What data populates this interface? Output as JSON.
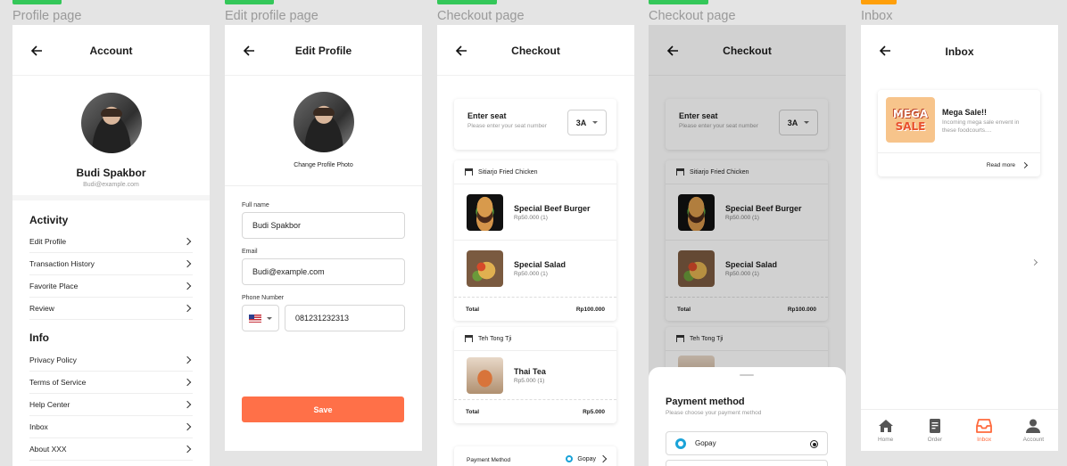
{
  "frames": [
    {
      "title": "Profile page",
      "tag_color": "#34c759"
    },
    {
      "title": "Edit profile page",
      "tag_color": "#34c759"
    },
    {
      "title": "Checkout page",
      "tag_color": "#34c759"
    },
    {
      "title": "Checkout page",
      "tag_color": "#34c759"
    },
    {
      "title": "Inbox",
      "tag_color": "#ff9f0a"
    }
  ],
  "account": {
    "header": "Account",
    "name": "Budi Spakbor",
    "email": "Budi@example.com",
    "activity_title": "Activity",
    "activity_items": [
      "Edit Profile",
      "Transaction History",
      "Favorite Place",
      "Review"
    ],
    "info_title": "Info",
    "info_items": [
      "Privacy Policy",
      "Terms of Service",
      "Help Center",
      "Inbox",
      "About XXX"
    ]
  },
  "edit_profile": {
    "header": "Edit Profile",
    "change_photo": "Change Profile Photo",
    "full_name_label": "Full name",
    "full_name_value": "Budi Spakbor",
    "email_label": "Email",
    "email_value": "Budi@example.com",
    "phone_label": "Phone Number",
    "phone_value": "081231232313",
    "save_label": "Save"
  },
  "checkout": {
    "header": "Checkout",
    "seat_title": "Enter seat",
    "seat_desc": "Please enter your seat number",
    "seat_value": "3A",
    "store1": "Sitiarjo Fried Chicken",
    "item1_name": "Special Beef Burger",
    "item1_price": "Rp50.000",
    "item1_qty": "(1)",
    "item2_name": "Special Salad",
    "item2_price": "Rp50.000",
    "item2_qty": "(1)",
    "total_label": "Total",
    "total1": "Rp100.000",
    "store2": "Teh Tong Tji",
    "item3_name": "Thai Tea",
    "item3_price": "Rp5.000",
    "item3_qty": "(1)",
    "total2": "Rp5.000",
    "payment_label": "Payment Method",
    "payment_value": "Gopay"
  },
  "payment_sheet": {
    "title": "Payment method",
    "desc": "Please choose your payment method",
    "option1": "Gopay"
  },
  "inbox": {
    "header": "Inbox",
    "banner_line1": "MEGA",
    "banner_line2": "SALE",
    "msg_title": "Mega Sale!!",
    "msg_desc": "Incoming mega sale envent in these foodcourts....",
    "read_more": "Read more",
    "nav": [
      "Home",
      "Order",
      "Inbox",
      "Account"
    ],
    "accent": "#ff6a3d"
  }
}
